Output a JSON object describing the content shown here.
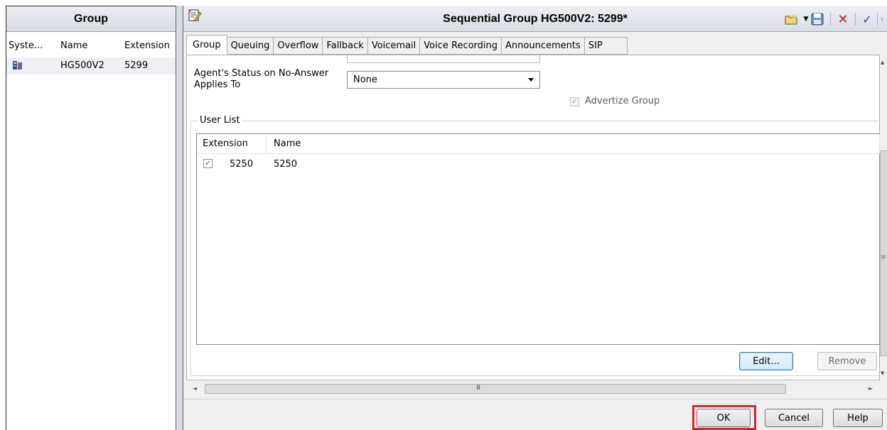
{
  "left_pane": {
    "header": "Group",
    "columns": [
      "Syste...",
      "Name",
      "Extension"
    ],
    "rows": [
      {
        "system_icon": "system-node-icon",
        "name": "HG500V2",
        "extension": "5299"
      }
    ]
  },
  "window": {
    "title": "Sequential Group HG500V2: 5299*",
    "toolbar_icons": [
      "new-folder-icon",
      "dropdown-arrow-icon",
      "save-icon",
      "delete-icon",
      "checkmark-icon",
      "back-icon",
      "forward-icon"
    ]
  },
  "tabs": [
    {
      "label": "Group",
      "active": true
    },
    {
      "label": "Queuing"
    },
    {
      "label": "Overflow"
    },
    {
      "label": "Fallback"
    },
    {
      "label": "Voicemail"
    },
    {
      "label": "Voice Recording"
    },
    {
      "label": "Announcements"
    },
    {
      "label": "SIP"
    }
  ],
  "group_tab": {
    "no_answer_label": "Agent's Status on No-Answer Applies To",
    "no_answer_value": "None",
    "advertize_label": "Advertize Group",
    "advertize_checked": true,
    "user_list": {
      "legend": "User List",
      "columns": [
        "Extension",
        "Name"
      ],
      "rows": [
        {
          "checked": true,
          "extension": "5250",
          "name": "5250"
        }
      ],
      "edit_label": "Edit...",
      "remove_label": "Remove"
    }
  },
  "buttons": {
    "ok": "OK",
    "cancel": "Cancel",
    "help": "Help"
  },
  "scroll_symbols": {
    "left": "◄",
    "right": "►",
    "up": "▲",
    "down": "▼",
    "grip_h": "III",
    "grip_v": "≡"
  },
  "colors": {
    "highlight": "#e0202a",
    "delete_red": "#d0121b",
    "check_blue": "#1e4ba0"
  }
}
